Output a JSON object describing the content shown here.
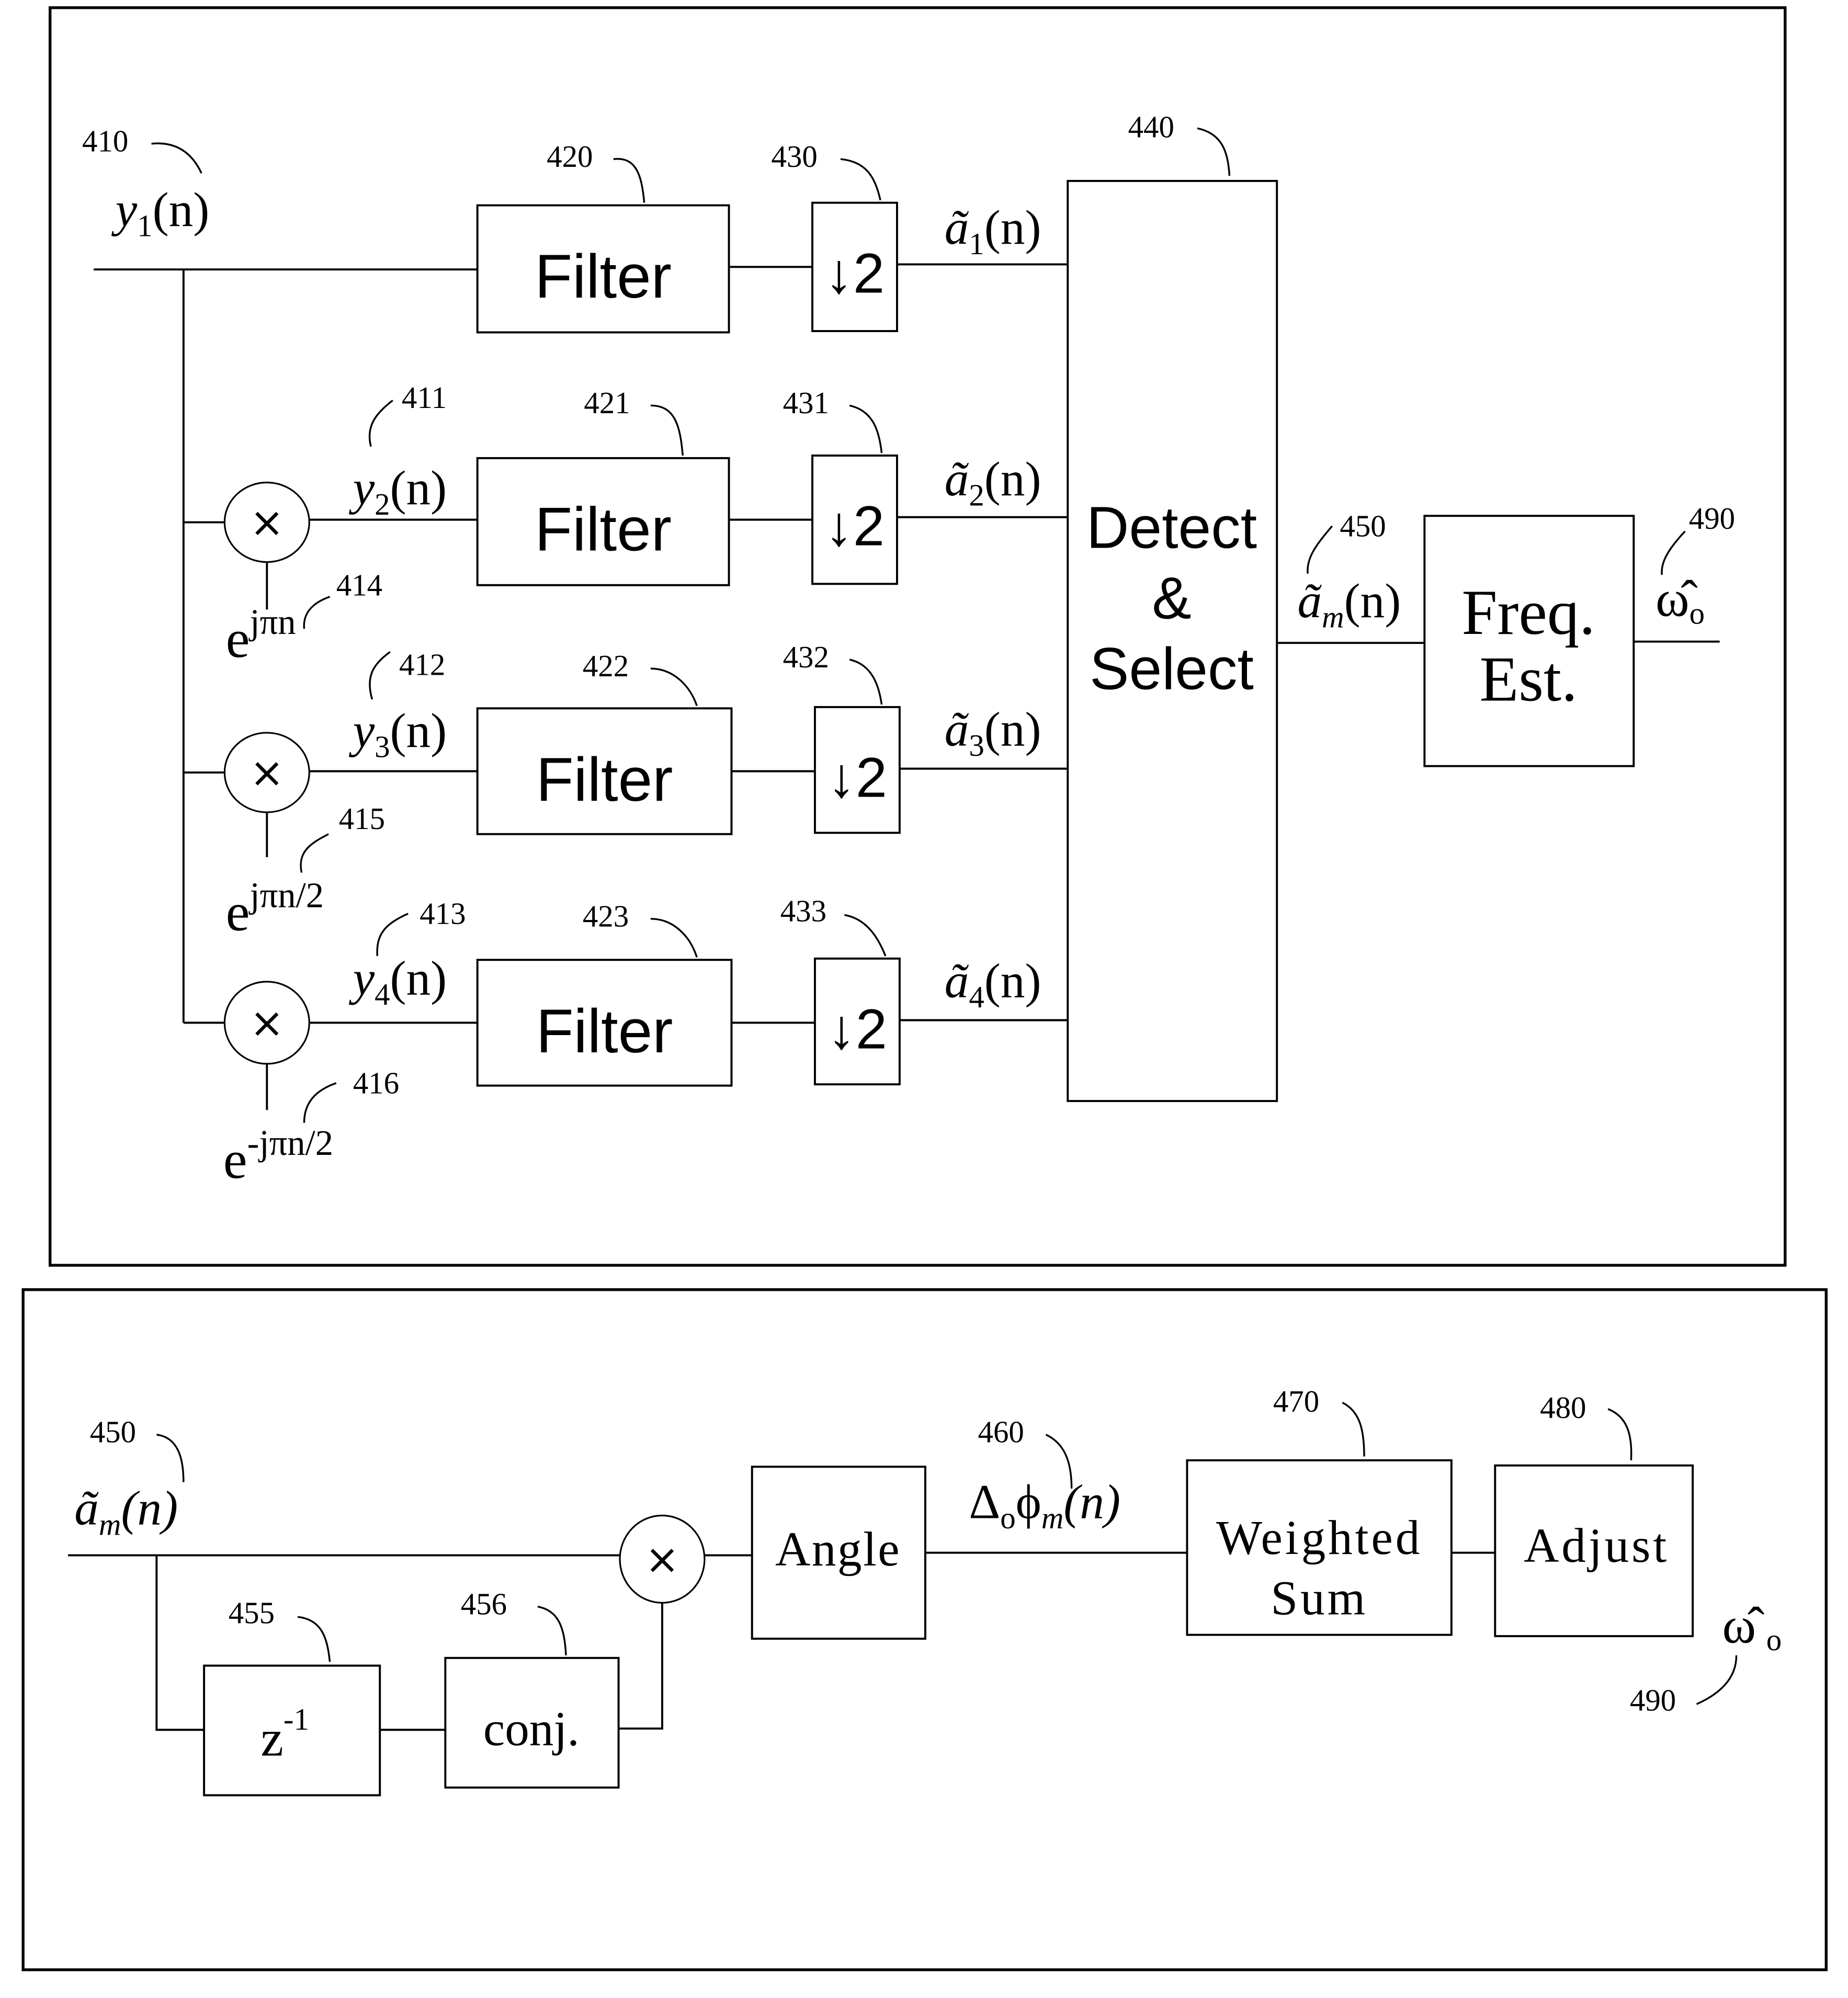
{
  "figure": {
    "top_panel": {
      "input": {
        "ref": "410",
        "signal_base": "y",
        "signal_sub": "1",
        "signal_arg": "(n)"
      },
      "branches": [
        {
          "mixer": null,
          "signal_ref": null,
          "signal_base": null,
          "signal_sub": null,
          "signal_arg": null,
          "filter": {
            "ref": "420",
            "label": "Filter"
          },
          "decimator": {
            "ref": "430",
            "label": "↓2"
          },
          "output": {
            "base": "ã",
            "sub": "1",
            "arg": "(n)"
          }
        },
        {
          "mixer": {
            "symbol": "×",
            "ref": "414",
            "exp_base": "e",
            "exponent": "jπn"
          },
          "signal_ref": "411",
          "signal_base": "y",
          "signal_sub": "2",
          "signal_arg": "(n)",
          "filter": {
            "ref": "421",
            "label": "Filter"
          },
          "decimator": {
            "ref": "431",
            "label": "↓2"
          },
          "output": {
            "base": "ã",
            "sub": "2",
            "arg": "(n)"
          }
        },
        {
          "mixer": {
            "symbol": "×",
            "ref": "415",
            "exp_base": "e",
            "exponent": "jπn/2"
          },
          "signal_ref": "412",
          "signal_base": "y",
          "signal_sub": "3",
          "signal_arg": "(n)",
          "filter": {
            "ref": "422",
            "label": "Filter"
          },
          "decimator": {
            "ref": "432",
            "label": "↓2"
          },
          "output": {
            "base": "ã",
            "sub": "3",
            "arg": "(n)"
          }
        },
        {
          "mixer": {
            "symbol": "×",
            "ref": "416",
            "exp_base": "e",
            "exponent": "-jπn/2"
          },
          "signal_ref": "413",
          "signal_base": "y",
          "signal_sub": "4",
          "signal_arg": "(n)",
          "filter": {
            "ref": "423",
            "label": "Filter"
          },
          "decimator": {
            "ref": "433",
            "label": "↓2"
          },
          "output": {
            "base": "ã",
            "sub": "4",
            "arg": "(n)"
          }
        }
      ],
      "detect_select": {
        "ref": "440",
        "lines": [
          "Detect",
          "&",
          "Select"
        ]
      },
      "selected": {
        "ref": "450",
        "base": "ã",
        "sub": "m",
        "arg": "(n)"
      },
      "freq_est": {
        "lines": [
          "Freq.",
          "Est."
        ]
      },
      "output": {
        "ref": "490",
        "symbol": "ω̂",
        "sub": "o"
      }
    },
    "bottom_panel": {
      "input": {
        "ref": "450",
        "base": "ã",
        "sub": "m",
        "arg": "(n)"
      },
      "delay": {
        "ref": "455",
        "label": "z",
        "sup": "-1"
      },
      "conj": {
        "ref": "456",
        "label": "conj."
      },
      "mixer": {
        "symbol": "×"
      },
      "angle": {
        "label": "Angle"
      },
      "phase_diff": {
        "ref": "460",
        "delta": "Δ",
        "delta_sub": "o",
        "phi": "ϕ",
        "phi_sub": "m",
        "arg": "(n)"
      },
      "weighted_sum": {
        "ref": "470",
        "lines": [
          "Weighted",
          "Sum"
        ]
      },
      "adjust": {
        "ref": "480",
        "label": "Adjust"
      },
      "output": {
        "ref": "490",
        "symbol": "ω̂",
        "sub": "o"
      }
    }
  }
}
